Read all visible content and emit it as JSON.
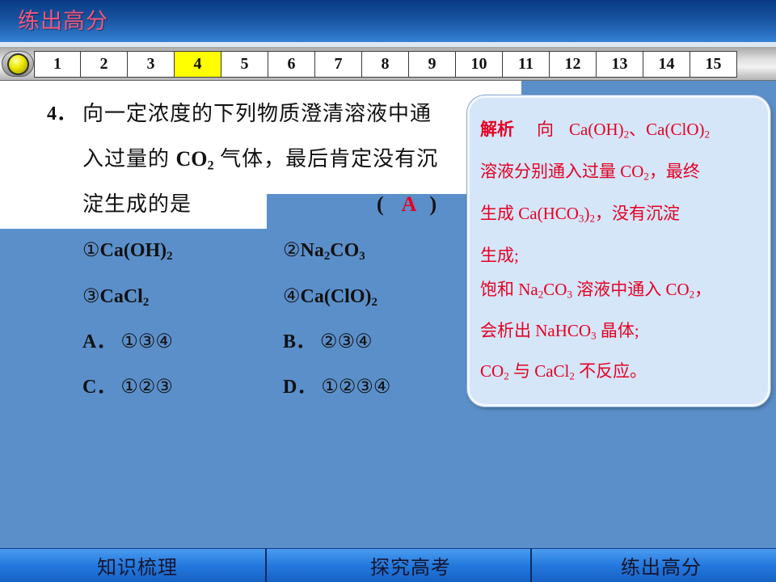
{
  "colors": {
    "header_title": "#f3577a",
    "body_blue": "#5b8fc9",
    "current_page_fill": "#ffff00",
    "answer_red": "#e60023",
    "explanation_text": "#e60023",
    "panel_fill": "#d4e6f8"
  },
  "header": {
    "title": "练出高分"
  },
  "nav": {
    "knob_icon": "knob-icon",
    "pages": [
      "1",
      "2",
      "3",
      "4",
      "5",
      "6",
      "7",
      "8",
      "9",
      "10",
      "11",
      "12",
      "13",
      "14",
      "15"
    ],
    "current_page": 4
  },
  "question": {
    "number": "4．",
    "line1": "向一定浓度的下列物质澄清溶液中通",
    "line2": [
      "入过量的 ",
      "CO",
      "2",
      " 气体，最后肯定没有沉"
    ],
    "line3": "淀生成的是",
    "answer": {
      "open": "(",
      "value": "A",
      "close": ")"
    },
    "options": [
      {
        "label": "①",
        "formula": [
          "Ca(OH)",
          "2"
        ]
      },
      {
        "label": "②",
        "formula": [
          "Na",
          "2",
          "CO",
          "3"
        ]
      },
      {
        "label": "③",
        "formula": [
          "CaCl",
          "2"
        ]
      },
      {
        "label": "④",
        "formula": [
          "Ca(ClO)",
          "2"
        ]
      }
    ],
    "choices": [
      {
        "letter": "A．",
        "value": "①③④"
      },
      {
        "letter": "B．",
        "value": "②③④"
      },
      {
        "letter": "C．",
        "value": "①②③"
      },
      {
        "letter": "D．",
        "value": "①②③④"
      }
    ]
  },
  "explanation": {
    "heading": "解析",
    "lines": [
      [
        "向",
        "Ca(OH)",
        "2",
        "、Ca(ClO)",
        "2"
      ],
      [
        "溶液分别通入过量 CO",
        "2",
        "，最终"
      ],
      [
        "生成 Ca(HCO",
        "3",
        ")",
        "2",
        "，没有沉淀"
      ],
      [
        "生成;"
      ],
      [
        "饱和 Na",
        "2",
        "CO",
        "3",
        " 溶液中通入 CO",
        "2",
        "，"
      ],
      [
        "会析出 NaHCO",
        "3",
        " 晶体;"
      ],
      [
        "CO",
        "2",
        " 与 CaCl",
        "2",
        " 不反应。"
      ]
    ]
  },
  "footer": {
    "tabs": [
      "知识梳理",
      "探究高考",
      "练出高分"
    ]
  }
}
